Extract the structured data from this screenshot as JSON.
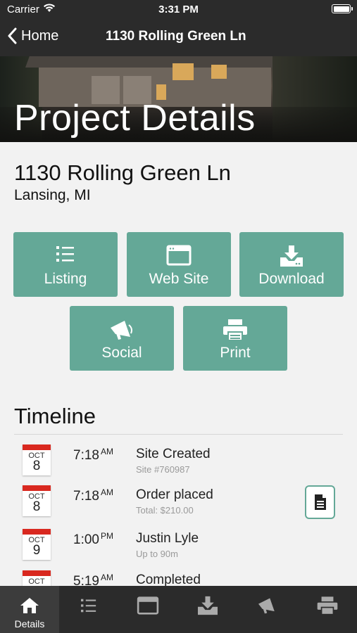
{
  "status_bar": {
    "carrier": "Carrier",
    "time": "3:31 PM"
  },
  "nav": {
    "back_label": "Home",
    "title": "1130 Rolling Green Ln"
  },
  "hero": {
    "title": "Project Details"
  },
  "address": {
    "street": "1130 Rolling Green Ln",
    "city": "Lansing, MI"
  },
  "actions": [
    {
      "label": "Listing",
      "icon": "list-icon"
    },
    {
      "label": "Web Site",
      "icon": "browser-window-icon"
    },
    {
      "label": "Download",
      "icon": "download-tray-icon"
    },
    {
      "label": "Social",
      "icon": "megaphone-icon"
    },
    {
      "label": "Print",
      "icon": "printer-icon"
    }
  ],
  "timeline": {
    "title": "Timeline",
    "items": [
      {
        "month": "OCT",
        "day": "8",
        "time": "7:18",
        "ampm": "AM",
        "title": "Site Created",
        "subtitle": "Site #760987",
        "has_doc": false
      },
      {
        "month": "OCT",
        "day": "8",
        "time": "7:18",
        "ampm": "AM",
        "title": "Order placed",
        "subtitle": "Total: $210.00",
        "has_doc": true
      },
      {
        "month": "OCT",
        "day": "9",
        "time": "1:00",
        "ampm": "PM",
        "title": "Justin Lyle",
        "subtitle": "Up to 90m",
        "has_doc": false
      },
      {
        "month": "OCT",
        "day": "",
        "time": "5:19",
        "ampm": "AM",
        "title": "Completed",
        "subtitle": "",
        "has_doc": false
      }
    ]
  },
  "tab_bar": {
    "active_label": "Details",
    "tabs": [
      "home-icon",
      "list-icon",
      "browser-window-icon",
      "download-tray-icon",
      "megaphone-icon",
      "printer-icon"
    ]
  },
  "colors": {
    "accent": "#64a897",
    "bar": "#2b2b2b",
    "calendar_red": "#d9281f"
  }
}
